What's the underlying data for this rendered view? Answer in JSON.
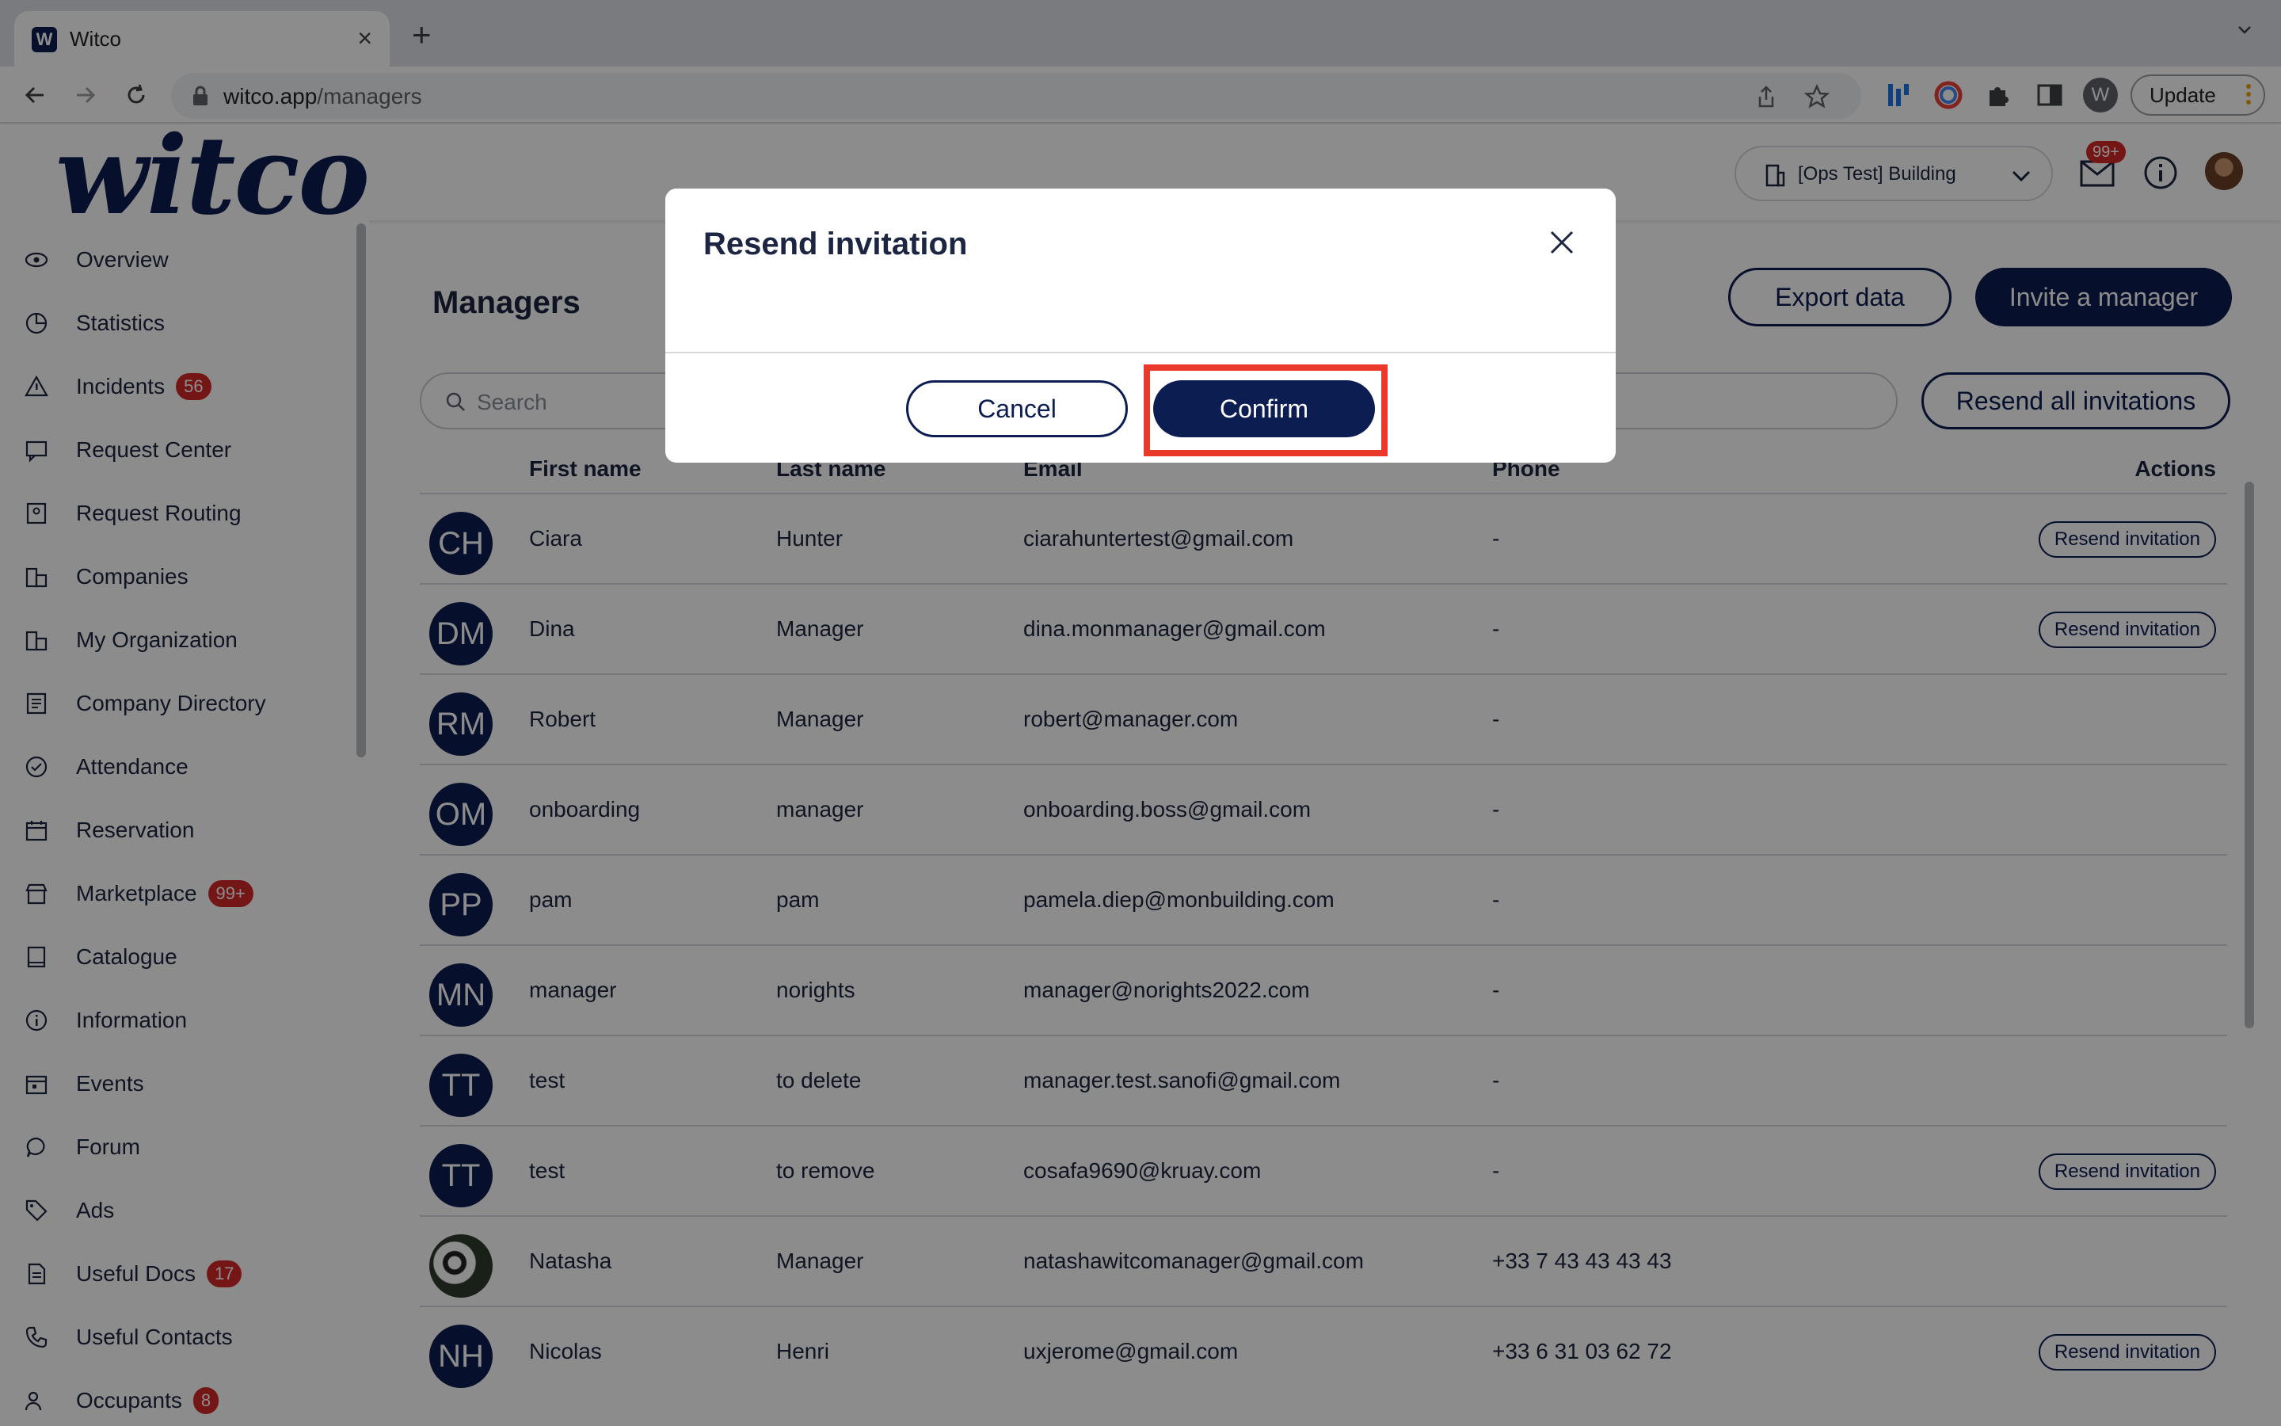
{
  "browser": {
    "tab_title": "Witco",
    "tab_favicon_letter": "W",
    "url_host": "witco.app",
    "url_path": "/managers",
    "profile_letter": "W",
    "update_label": "Update"
  },
  "header": {
    "logo": "witco",
    "building": "[Ops Test] Building",
    "mail_badge": "99+"
  },
  "sidebar": {
    "items": [
      {
        "label": "Overview",
        "icon": "eye-icon"
      },
      {
        "label": "Statistics",
        "icon": "pie-chart-icon"
      },
      {
        "label": "Incidents",
        "icon": "warning-icon",
        "badge": "56"
      },
      {
        "label": "Request Center",
        "icon": "chat-icon"
      },
      {
        "label": "Request Routing",
        "icon": "routing-icon"
      },
      {
        "label": "Companies",
        "icon": "buildings-icon"
      },
      {
        "label": "My Organization",
        "icon": "buildings-icon"
      },
      {
        "label": "Company Directory",
        "icon": "directory-icon"
      },
      {
        "label": "Attendance",
        "icon": "check-circle-icon"
      },
      {
        "label": "Reservation",
        "icon": "calendar-icon"
      },
      {
        "label": "Marketplace",
        "icon": "store-icon",
        "badge": "99+"
      },
      {
        "label": "Catalogue",
        "icon": "book-icon"
      },
      {
        "label": "Information",
        "icon": "info-icon"
      },
      {
        "label": "Events",
        "icon": "calendar-event-icon"
      },
      {
        "label": "Forum",
        "icon": "speech-bubble-icon"
      },
      {
        "label": "Ads",
        "icon": "tag-icon"
      },
      {
        "label": "Useful Docs",
        "icon": "document-icon",
        "badge": "17"
      },
      {
        "label": "Useful Contacts",
        "icon": "phone-icon"
      },
      {
        "label": "Occupants",
        "icon": "people-icon",
        "badge": "8"
      }
    ]
  },
  "main": {
    "title": "Managers",
    "export_label": "Export data",
    "invite_label": "Invite a manager",
    "search_placeholder": "Search",
    "resend_all_label": "Resend all invitations",
    "columns": {
      "first_name": "First name",
      "last_name": "Last name",
      "email": "Email",
      "phone": "Phone",
      "actions": "Actions"
    },
    "resend_label": "Resend invitation",
    "rows": [
      {
        "initials": "CH",
        "first": "Ciara",
        "last": "Hunter",
        "email": "ciarahuntertest@gmail.com",
        "phone": "-",
        "resend": true
      },
      {
        "initials": "DM",
        "first": "Dina",
        "last": "Manager",
        "email": "dina.monmanager@gmail.com",
        "phone": "-",
        "resend": true
      },
      {
        "initials": "RM",
        "first": "Robert",
        "last": "Manager",
        "email": "robert@manager.com",
        "phone": "-",
        "resend": false
      },
      {
        "initials": "OM",
        "first": "onboarding",
        "last": "manager",
        "email": "onboarding.boss@gmail.com",
        "phone": "-",
        "resend": false
      },
      {
        "initials": "PP",
        "first": "pam",
        "last": "pam",
        "email": "pamela.diep@monbuilding.com",
        "phone": "-",
        "resend": false
      },
      {
        "initials": "MN",
        "first": "manager",
        "last": "norights",
        "email": "manager@norights2022.com",
        "phone": "-",
        "resend": false
      },
      {
        "initials": "TT",
        "first": "test",
        "last": "to delete",
        "email": "manager.test.sanofi@gmail.com",
        "phone": "-",
        "resend": false
      },
      {
        "initials": "TT",
        "first": "test",
        "last": "to remove",
        "email": "cosafa9690@kruay.com",
        "phone": "-",
        "resend": true
      },
      {
        "initials": "",
        "first": "Natasha",
        "last": "Manager",
        "email": "natashawitcomanager@gmail.com",
        "phone": "+33 7 43 43 43 43",
        "resend": false,
        "photo": true
      },
      {
        "initials": "NH",
        "first": "Nicolas",
        "last": "Henri",
        "email": "uxjerome@gmail.com",
        "phone": "+33 6 31 03 62 72",
        "resend": true
      }
    ]
  },
  "modal": {
    "title": "Resend invitation",
    "cancel_label": "Cancel",
    "confirm_label": "Confirm"
  },
  "colors": {
    "brand": "#0b1d51",
    "badge": "#d62828",
    "highlight": "#e8392a"
  }
}
